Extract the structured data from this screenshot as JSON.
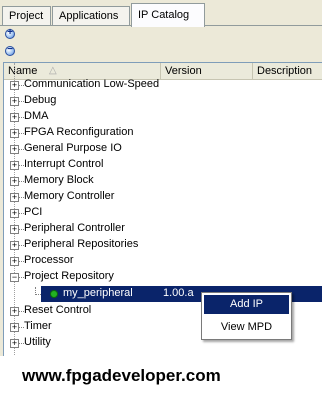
{
  "tabs": [
    {
      "label": "Project"
    },
    {
      "label": "Applications"
    },
    {
      "label": "IP Catalog"
    }
  ],
  "active_tab": "IP Catalog",
  "toolbar": {
    "expand_icon": "+",
    "collapse_icon": "−"
  },
  "columns": [
    {
      "label": "Name"
    },
    {
      "label": "Version"
    },
    {
      "label": "Description"
    }
  ],
  "tree": {
    "items": [
      {
        "label": "Communication Low-Speed",
        "expander": "+"
      },
      {
        "label": "Debug",
        "expander": "+"
      },
      {
        "label": "DMA",
        "expander": "+"
      },
      {
        "label": "FPGA Reconfiguration",
        "expander": "+"
      },
      {
        "label": "General Purpose IO",
        "expander": "+"
      },
      {
        "label": "Interrupt Control",
        "expander": "+"
      },
      {
        "label": "Memory Block",
        "expander": "+"
      },
      {
        "label": "Memory Controller",
        "expander": "+"
      },
      {
        "label": "PCI",
        "expander": "+"
      },
      {
        "label": "Peripheral Controller",
        "expander": "+"
      },
      {
        "label": "Peripheral Repositories",
        "expander": "+"
      },
      {
        "label": "Processor",
        "expander": "+"
      },
      {
        "label": "Project Repository",
        "expander": "−"
      },
      {
        "label": "Reset Control",
        "expander": "+"
      },
      {
        "label": "Timer",
        "expander": "+"
      },
      {
        "label": "Utility",
        "expander": "+"
      }
    ],
    "selected_item": {
      "label": "my_peripheral",
      "version": "1.00.a"
    }
  },
  "context_menu": {
    "items": [
      {
        "label": "Add IP"
      },
      {
        "label": "View MPD"
      }
    ]
  },
  "footer": {
    "text": "www.fpgadeveloper.com"
  },
  "colors": {
    "selection": "#0a246a",
    "panel": "#ece9d8",
    "bullet": "#22b222"
  }
}
